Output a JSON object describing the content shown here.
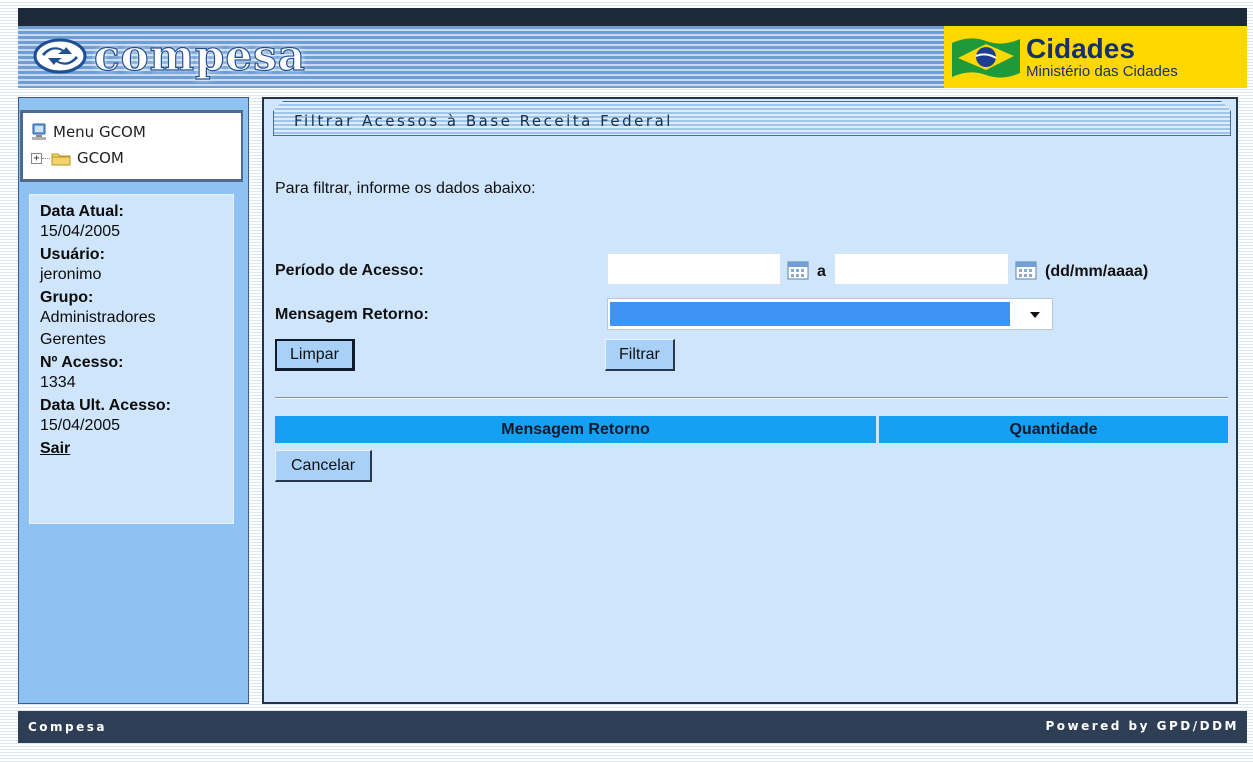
{
  "header": {
    "logo_text": "compesa",
    "cidades_title": "Cidades",
    "cidades_subtitle": "Ministério das Cidades"
  },
  "sidebar": {
    "menu_title": "Menu GCOM",
    "tree_node": "GCOM",
    "info": {
      "data_atual_label": "Data Atual:",
      "data_atual_value": "15/04/2005",
      "usuario_label": "Usuário:",
      "usuario_value": "jeronimo",
      "grupo_label": "Grupo:",
      "grupo_value_1": "Administradores",
      "grupo_value_2": "Gerentes",
      "acesso_label": "Nº Acesso:",
      "acesso_value": "1334",
      "ult_acesso_label": "Data Ult. Acesso:",
      "ult_acesso_value": "15/04/2005"
    },
    "sair_label": "Sair"
  },
  "main": {
    "title": "Filtrar Acessos à Base Receita Federal",
    "instructions": "Para filtrar, informe os dados abaixo:",
    "periodo_label": "Período de Acesso:",
    "periodo_start_value": "",
    "periodo_end_value": "",
    "periodo_sep": "a",
    "date_format_hint": "(dd/mm/aaaa)",
    "mensagem_label": "Mensagem Retorno:",
    "mensagem_selected": "",
    "limpar_label": "Limpar",
    "filtrar_label": "Filtrar",
    "table": {
      "columns": [
        "Mensagem Retorno",
        "Quantidade"
      ],
      "rows": []
    },
    "cancelar_label": "Cancelar"
  },
  "footer": {
    "left": "Compesa",
    "right": "Powered by GPD/DDM"
  },
  "icons": {
    "logo": "compesa-logo-icon",
    "flag": "brazil-flag-icon",
    "computer": "computer-icon",
    "expand": "plus-expand-icon",
    "folder": "folder-icon",
    "calendar": "calendar-icon",
    "dropdown": "chevron-down-icon"
  },
  "colors": {
    "accent": "#14a1f3",
    "panel_bg": "#cfe5fb",
    "sidebar_bg": "#8ec2f2",
    "footer_bg": "#2e3f55",
    "cidades_bg": "#ffd800",
    "button_bg": "#a9d0f6"
  }
}
